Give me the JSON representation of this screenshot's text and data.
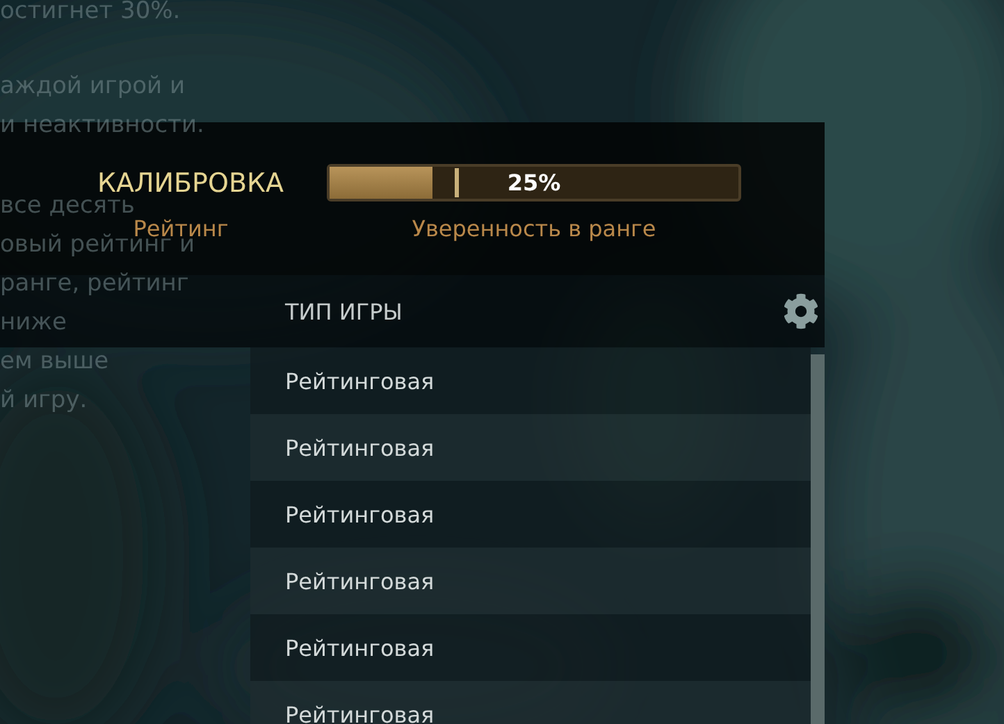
{
  "background_text": [
    [
      "остигнет 30%."
    ],
    [
      "аждой игрой и",
      "и неактивности."
    ],
    [
      "все десять",
      "овый рейтинг и",
      "ранге, рейтинг",
      "ниже",
      "ем выше",
      "й игру."
    ]
  ],
  "calibration": {
    "title": "КАЛИБРОВКА",
    "rating_label": "Рейтинг",
    "confidence": {
      "level": 0.25,
      "reading": "25%",
      "label": "Уверенность в ранге"
    }
  },
  "games": {
    "column": "ТИП ИГРЫ",
    "rows": [
      {
        "game_type": "Рейтинговая"
      },
      {
        "game_type": "Рейтинговая"
      },
      {
        "game_type": "Рейтинговая"
      },
      {
        "game_type": "Рейтинговая"
      },
      {
        "game_type": "Рейтинговая"
      },
      {
        "game_type": "Рейтинговая"
      }
    ]
  }
}
